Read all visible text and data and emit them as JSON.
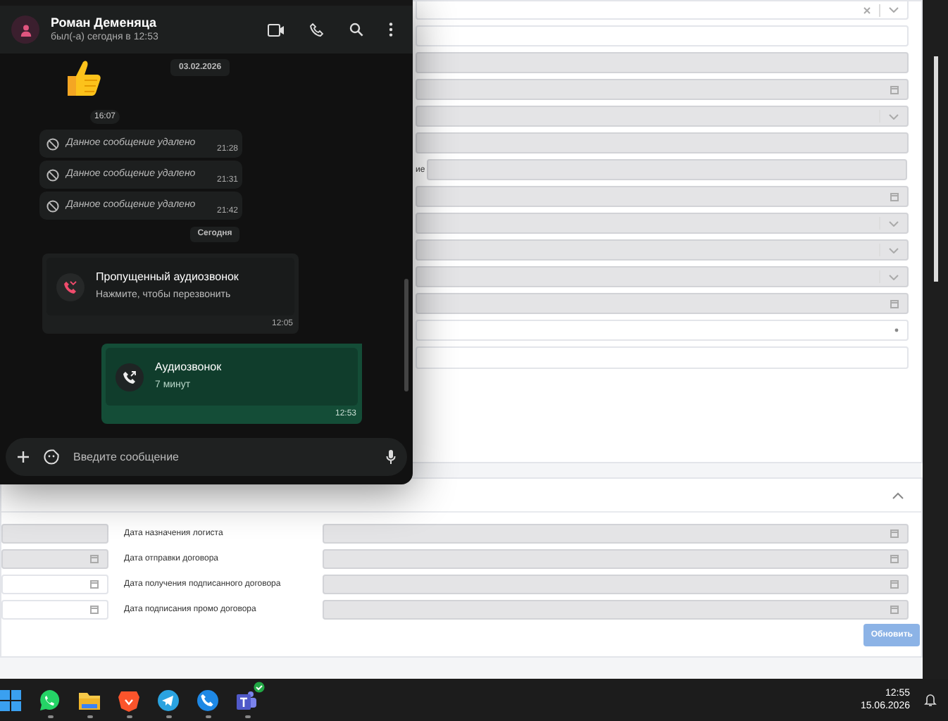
{
  "form": {
    "fields": [
      {
        "kind": "select-clear",
        "disabled": false
      },
      {
        "kind": "text",
        "disabled": false
      },
      {
        "kind": "text",
        "disabled": true
      },
      {
        "kind": "date",
        "disabled": true
      },
      {
        "kind": "select",
        "disabled": true
      },
      {
        "kind": "text",
        "disabled": true
      },
      {
        "kind": "text",
        "disabled": true,
        "label": "ие"
      },
      {
        "kind": "date",
        "disabled": true
      },
      {
        "kind": "select",
        "disabled": true
      },
      {
        "kind": "select",
        "disabled": true
      },
      {
        "kind": "select",
        "disabled": true
      },
      {
        "kind": "date",
        "disabled": true
      },
      {
        "kind": "required",
        "disabled": false
      },
      {
        "kind": "text",
        "disabled": false
      }
    ]
  },
  "section": {
    "expanded": true,
    "rows": [
      {
        "left": {
          "kind": "text",
          "disabled": true
        },
        "label": "Дата назначения логиста",
        "right": {
          "kind": "date",
          "disabled": true
        }
      },
      {
        "left": {
          "kind": "date",
          "disabled": true
        },
        "label": "Дата отправки договора",
        "right": {
          "kind": "date",
          "disabled": true
        }
      },
      {
        "left": {
          "kind": "date",
          "disabled": false
        },
        "label": "Дата получения подписанного договора",
        "right": {
          "kind": "date",
          "disabled": true
        }
      },
      {
        "left": {
          "kind": "date",
          "disabled": false
        },
        "label": "Дата подписания промо договора",
        "right": {
          "kind": "date",
          "disabled": true
        }
      }
    ],
    "button": "Обновить"
  },
  "chat": {
    "contact": "Роман Деменяца",
    "status": "был(-а) сегодня в 12:53",
    "messages": [
      {
        "kind": "sticker",
        "date": "03.02.2026",
        "time": "16:07"
      },
      {
        "kind": "deleted",
        "text": "Данное сообщение удалено",
        "time": "21:28"
      },
      {
        "kind": "deleted",
        "text": "Данное сообщение удалено",
        "time": "21:31"
      },
      {
        "kind": "deleted",
        "text": "Данное сообщение удалено",
        "time": "21:42"
      },
      {
        "kind": "chip",
        "text": "Сегодня"
      },
      {
        "kind": "missed-call",
        "title": "Пропущенный аудиозвонок",
        "subtitle": "Нажмите, чтобы перезвонить",
        "time": "12:05"
      },
      {
        "kind": "outgoing-call",
        "title": "Аудиозвонок",
        "subtitle": "7 минут",
        "time": "12:53"
      }
    ],
    "input": {
      "placeholder": "Введите сообщение"
    }
  },
  "taskbar": {
    "apps": [
      {
        "kind": "start"
      },
      {
        "kind": "whatsapp"
      },
      {
        "kind": "folder"
      },
      {
        "kind": "brave"
      },
      {
        "kind": "telegram"
      },
      {
        "kind": "phone"
      },
      {
        "kind": "teams"
      }
    ],
    "time": "12:55",
    "date": "15.06.2026"
  }
}
